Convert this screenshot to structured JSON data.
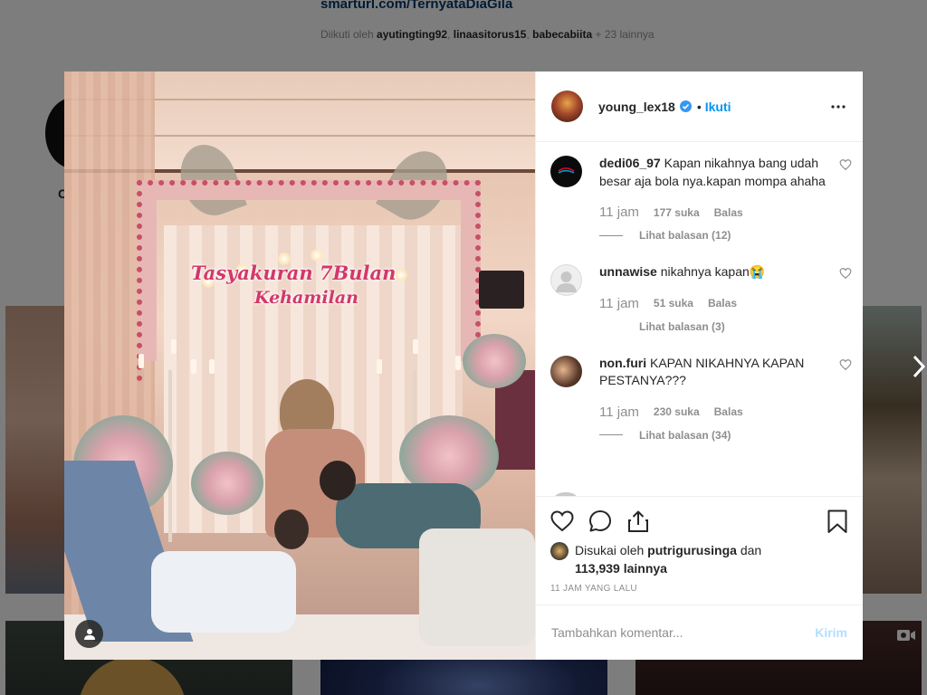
{
  "background": {
    "link": "smarturl.com/TernyataDiaGila",
    "followed_by_prefix": "Diikuti oleh",
    "followed_by_users": [
      "ayutingting92",
      "linaasitorus15",
      "babecabiita"
    ],
    "followed_by_suffix": "+ 23 lainnya",
    "profile_initial": "C"
  },
  "photo": {
    "banner_line1": "Tasyakuran 7Bulan",
    "banner_line2": "Kehamilan"
  },
  "header": {
    "username": "young_lex18",
    "separator": "•",
    "follow_label": "Ikuti"
  },
  "comments": [
    {
      "username": "dedi06_97",
      "text": "Kapan nikahnya bang udah besar aja bola nya.kapan mompa ahaha",
      "time": "11 jam",
      "likes": "177 suka",
      "reply_label": "Balas",
      "replies": "Lihat balasan (12)",
      "avatar_color": "#0b0b0b"
    },
    {
      "username": "unnawise",
      "text": "nikahnya kapan😭",
      "time": "11 jam",
      "likes": "51 suka",
      "reply_label": "Balas",
      "replies": "Lihat balasan (3)",
      "avatar_color": "#e9e9e9"
    },
    {
      "username": "non.furi",
      "text": "KAPAN NIKAHNYA KAPAN PESTANYA???",
      "time": "11 jam",
      "likes": "230 suka",
      "reply_label": "Balas",
      "replies": "Lihat balasan (34)",
      "avatar_color": "#5a3a2a"
    }
  ],
  "likes": {
    "prefix": "Disukai oleh",
    "user": "putrigurusinga",
    "conjunction": "dan",
    "count": "113,939 lainnya"
  },
  "timestamp": "11 JAM YANG LALU",
  "add_comment": {
    "placeholder": "Tambahkan komentar...",
    "post_label": "Kirim"
  },
  "colors": {
    "accent": "#0095f6",
    "post_disabled": "#b2dffc"
  }
}
